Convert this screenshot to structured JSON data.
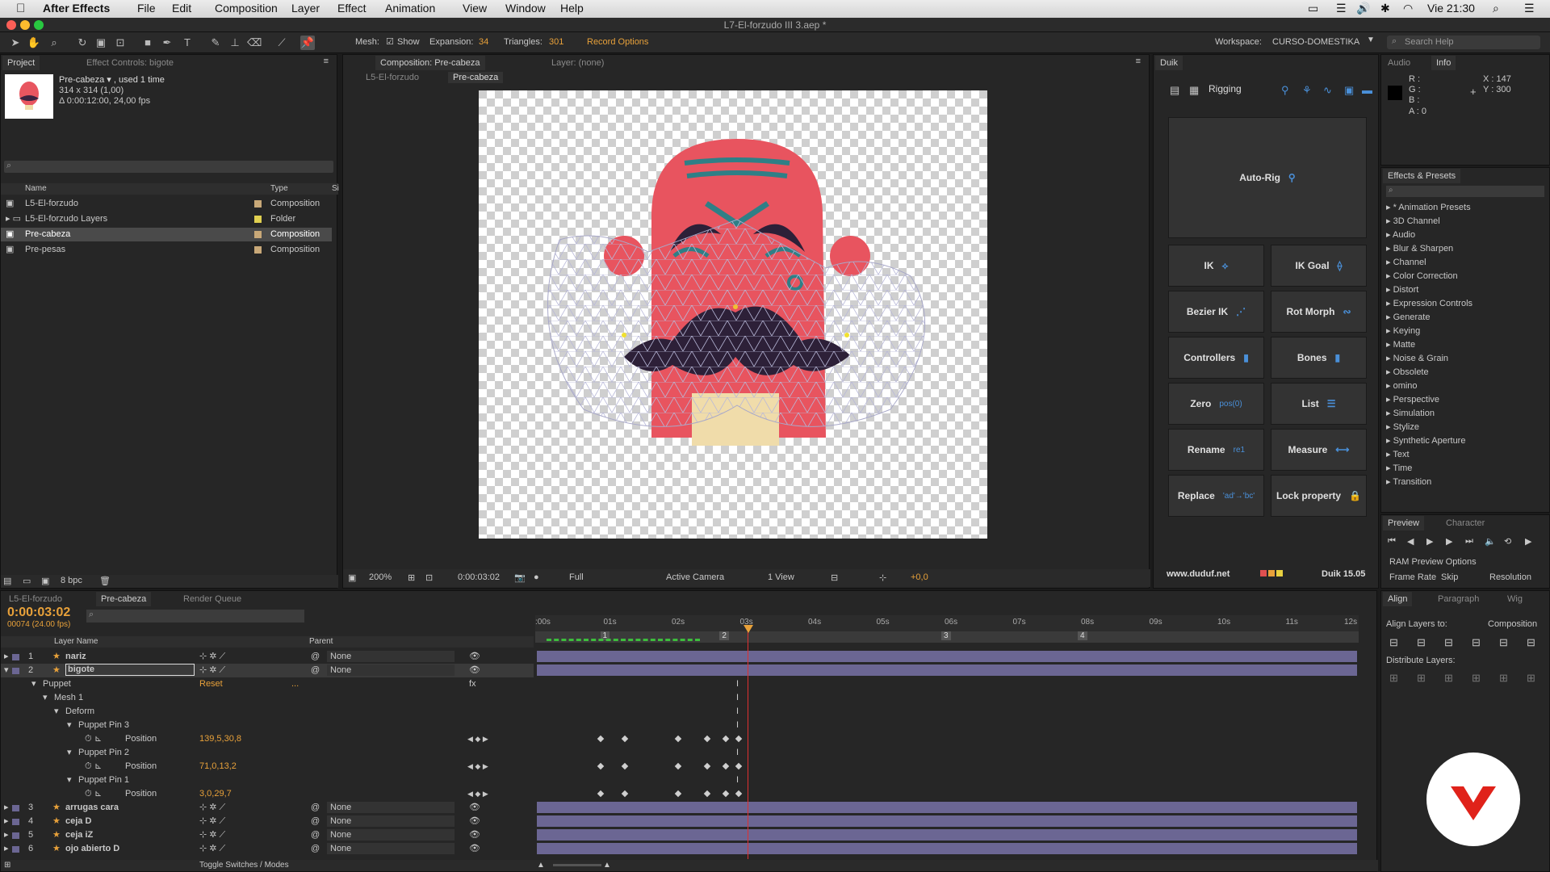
{
  "menubar": {
    "app": "After Effects",
    "items": [
      "File",
      "Edit",
      "Composition",
      "Layer",
      "Effect",
      "Animation",
      "View",
      "Window",
      "Help"
    ],
    "clock": "Vie 21:30"
  },
  "title": "L7-El-forzudo III 3.aep *",
  "toolbar": {
    "mesh": "Mesh:",
    "show": "Show",
    "expansion_label": "Expansion:",
    "expansion": "34",
    "triangles_label": "Triangles:",
    "triangles": "301",
    "record": "Record Options",
    "workspace_label": "Workspace:",
    "workspace": "CURSO-DOMESTIKA",
    "search": "Search Help"
  },
  "project": {
    "tab": "Project",
    "tab2": "Effect Controls: bigote",
    "name": "Pre-cabeza ▾ , used 1 time",
    "size": "314 x 314 (1,00)",
    "duration": "Δ 0:00:12:00, 24,00 fps",
    "col_name": "Name",
    "col_type": "Type",
    "col_s": "Si",
    "bpc": "8 bpc",
    "items": [
      {
        "name": "L5-El-forzudo",
        "type": "Composition",
        "color": "#c8a878"
      },
      {
        "name": "L5-El-forzudo Layers",
        "type": "Folder",
        "color": "#e0d050"
      },
      {
        "name": "Pre-cabeza",
        "type": "Composition",
        "color": "#c8a878"
      },
      {
        "name": "Pre-pesas",
        "type": "Composition",
        "color": "#c8a878"
      }
    ]
  },
  "comp": {
    "tab": "Composition: Pre-cabeza",
    "layer_tab": "Layer: (none)",
    "crumb1": "L5-El-forzudo",
    "crumb2": "Pre-cabeza",
    "zoom": "200%",
    "time": "0:00:03:02",
    "res": "Full",
    "camera": "Active Camera",
    "view": "1 View",
    "offset": "+0,0"
  },
  "duik": {
    "tab": "Duik",
    "rigging": "Rigging",
    "autorig": "Auto-Rig",
    "buttons": [
      [
        "IK",
        "IK Goal"
      ],
      [
        "Bezier IK",
        "Rot Morph"
      ],
      [
        "Controllers",
        "Bones"
      ],
      [
        "Zero",
        "List"
      ],
      [
        "Rename",
        "Measure"
      ],
      [
        "Replace",
        "Lock property"
      ]
    ],
    "zero_sub": "pos(0)",
    "rename_sub": "re1",
    "replace_sub": "'ad'→'bc'",
    "url": "www.duduf.net",
    "version": "Duik 15.05"
  },
  "info": {
    "tab1": "Audio",
    "tab2": "Info",
    "r": "R :",
    "g": "G :",
    "b": "B :",
    "a": "A : 0",
    "x": "X : 147",
    "y": "Y : 300"
  },
  "effects": {
    "tab": "Effects & Presets",
    "items": [
      "* Animation Presets",
      "3D Channel",
      "Audio",
      "Blur & Sharpen",
      "Channel",
      "Color Correction",
      "Distort",
      "Expression Controls",
      "Generate",
      "Keying",
      "Matte",
      "Noise & Grain",
      "Obsolete",
      "omino",
      "Perspective",
      "Simulation",
      "Stylize",
      "Synthetic Aperture",
      "Text",
      "Time",
      "Transition"
    ]
  },
  "preview": {
    "tab": "Preview",
    "tab2": "Character",
    "ram": "RAM Preview Options",
    "frame_rate": "Frame Rate",
    "skip": "Skip",
    "resolution": "Resolution"
  },
  "align": {
    "tab": "Align",
    "tab2": "Paragraph",
    "tab3": "Wig",
    "align_to_label": "Align Layers to:",
    "align_to": "Composition",
    "distribute": "Distribute Layers:"
  },
  "timeline": {
    "tab1": "L5-El-forzudo",
    "tab2": "Pre-cabeza",
    "tab3": "Render Queue",
    "time": "0:00:03:02",
    "frames": "00074 (24.00 fps)",
    "col_layer": "Layer Name",
    "col_parent": "Parent",
    "ticks": [
      ":00s",
      "01s",
      "02s",
      "03s",
      "04s",
      "05s",
      "06s",
      "07s",
      "08s",
      "09s",
      "10s",
      "11s",
      "12s"
    ],
    "markers": [
      "1",
      "2",
      "3",
      "4"
    ],
    "toggle": "Toggle Switches / Modes",
    "reset": "Reset",
    "dots": "...",
    "layers": [
      {
        "n": "1",
        "name": "nariz",
        "parent": "None"
      },
      {
        "n": "2",
        "name": "bigote",
        "parent": "None"
      },
      {
        "n": "3",
        "name": "arrugas cara",
        "parent": "None"
      },
      {
        "n": "4",
        "name": "ceja D",
        "parent": "None"
      },
      {
        "n": "5",
        "name": "ceja iZ",
        "parent": "None"
      },
      {
        "n": "6",
        "name": "ojo abierto D",
        "parent": "None"
      }
    ],
    "sub": {
      "puppet": "Puppet",
      "mesh": "Mesh 1",
      "deform": "Deform",
      "pin3": "Puppet Pin 3",
      "pin2": "Puppet Pin 2",
      "pin1": "Puppet Pin 1",
      "position": "Position",
      "v3": "139,5,30,8",
      "v2": "71,0,13,2",
      "v1": "3,0,29,7"
    }
  }
}
